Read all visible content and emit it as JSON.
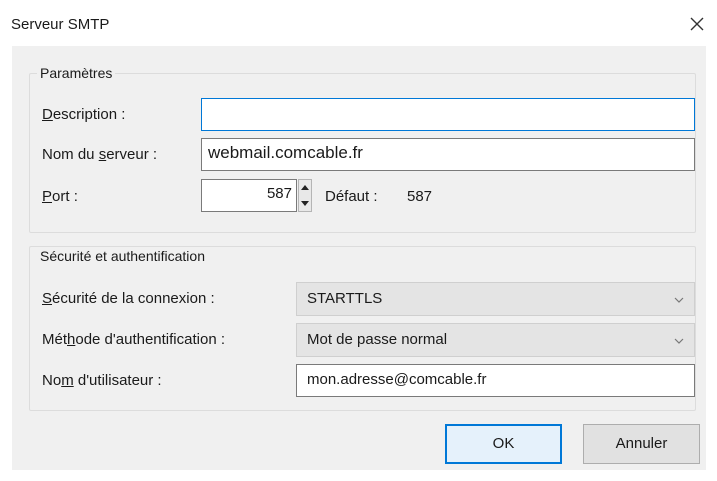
{
  "window": {
    "title": "Serveur SMTP",
    "close_icon": "close-icon"
  },
  "parametres": {
    "legend": "Paramètres",
    "description": {
      "label_u": "D",
      "label_rest": "escription :",
      "value": ""
    },
    "server": {
      "label_pre": "Nom du ",
      "label_u": "s",
      "label_rest": "erveur :",
      "value": "webmail.comcable.fr"
    },
    "port": {
      "label_u": "P",
      "label_rest": "ort :",
      "value": "587",
      "default_label": "Défaut :",
      "default_value": "587"
    }
  },
  "securite": {
    "legend": "Sécurité et authentification",
    "connection": {
      "label_u": "S",
      "label_rest": "écurité de la connexion :",
      "value": "STARTTLS"
    },
    "auth": {
      "label_pre": "Mét",
      "label_u": "h",
      "label_rest": "ode d'authentification :",
      "value": "Mot de passe normal"
    },
    "username": {
      "label_pre": "No",
      "label_u": "m",
      "label_rest": " d'utilisateur :",
      "value": "mon.adresse@comcable.fr"
    }
  },
  "buttons": {
    "ok": "OK",
    "cancel": "Annuler"
  }
}
